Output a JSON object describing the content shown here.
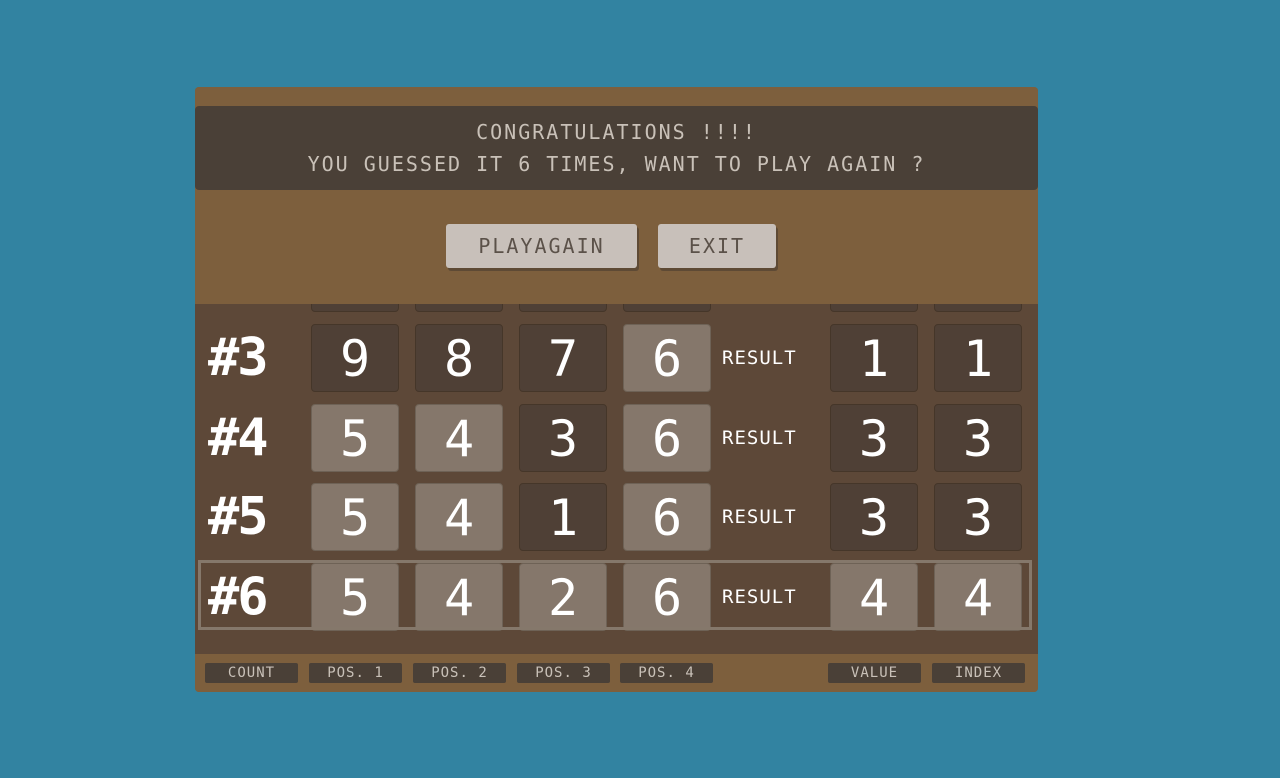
{
  "banner": {
    "line1": "CONGRATULATIONS !!!!",
    "line2": "YOU GUESSED IT 6 TIMES, WANT TO PLAY AGAIN ?"
  },
  "buttons": {
    "play_again": "PLAYAGAIN",
    "exit": "EXIT"
  },
  "rows": [
    {
      "count": "#3",
      "pos": [
        "9",
        "8",
        "7",
        "6"
      ],
      "result_label": "RESULT",
      "value": "1",
      "index": "1"
    },
    {
      "count": "#4",
      "pos": [
        "5",
        "4",
        "3",
        "6"
      ],
      "result_label": "RESULT",
      "value": "3",
      "index": "3"
    },
    {
      "count": "#5",
      "pos": [
        "5",
        "4",
        "1",
        "6"
      ],
      "result_label": "RESULT",
      "value": "3",
      "index": "3"
    },
    {
      "count": "#6",
      "pos": [
        "5",
        "4",
        "2",
        "6"
      ],
      "result_label": "RESULT",
      "value": "4",
      "index": "4"
    }
  ],
  "footer": {
    "count": "COUNT",
    "pos1": "POS. 1",
    "pos2": "POS. 2",
    "pos3": "POS. 3",
    "pos4": "POS. 4",
    "value": "VALUE",
    "index": "INDEX"
  },
  "colors": {
    "background": "#3283a1",
    "panel": "#7d5f3d",
    "board": "#5d4838",
    "cell_dark": "#4f4036",
    "cell_light": "#85776b"
  }
}
